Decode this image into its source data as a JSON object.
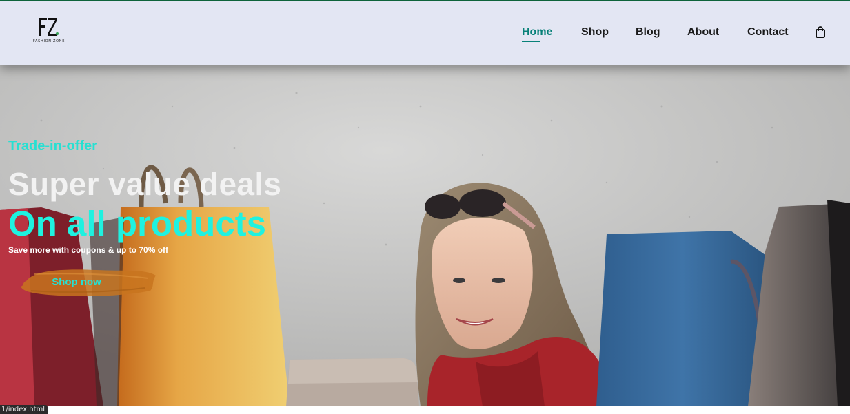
{
  "brand": {
    "logo_letters": "FZ",
    "logo_caption": "FASHION ZONE"
  },
  "nav": {
    "items": [
      {
        "label": "Home",
        "active": true
      },
      {
        "label": "Shop",
        "active": false
      },
      {
        "label": "Blog",
        "active": false
      },
      {
        "label": "About",
        "active": false
      },
      {
        "label": "Contact",
        "active": false
      }
    ],
    "cart_icon": "shopping-bag-icon"
  },
  "hero": {
    "tag": "Trade-in-offer",
    "heading": "Super value deals",
    "subheading": "On all products",
    "description": "Save more with coupons & up to 70% off",
    "button_label": "Shop now"
  },
  "status_bar": {
    "url": "1/index.html"
  },
  "colors": {
    "accent": "#088178",
    "header_bg": "#e3e6f3",
    "hero_highlight": "#1ff2e0",
    "button_brush": "#c8741f"
  }
}
